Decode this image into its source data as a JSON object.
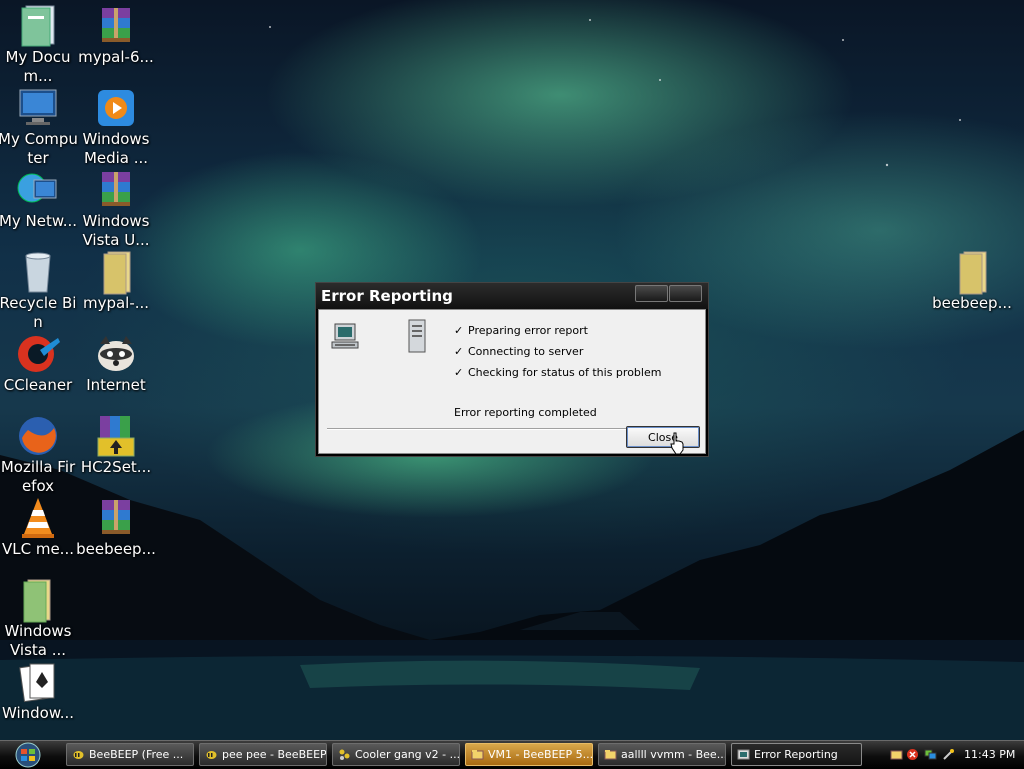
{
  "desktop_icons": [
    {
      "label": "My Docum...",
      "icon": "documents-folder-icon"
    },
    {
      "label": "mypal-6...",
      "icon": "winrar-archive-icon"
    },
    {
      "label": "My Computer",
      "icon": "computer-icon"
    },
    {
      "label": "Windows Media ...",
      "icon": "media-player-icon"
    },
    {
      "label": "My Netw...",
      "icon": "network-globe-icon"
    },
    {
      "label": "Windows Vista U...",
      "icon": "winrar-archive-icon"
    },
    {
      "label": "Recycle Bin",
      "icon": "recycle-bin-icon"
    },
    {
      "label": "mypal-...",
      "icon": "folder-icon"
    },
    {
      "label": "CCleaner",
      "icon": "ccleaner-icon"
    },
    {
      "label": "Internet",
      "icon": "raccoon-browser-icon"
    },
    {
      "label": "Mozilla Firefox",
      "icon": "firefox-icon"
    },
    {
      "label": "HC2Set...",
      "icon": "winrar-installer-icon"
    },
    {
      "label": "VLC me...",
      "icon": "vlc-cone-icon"
    },
    {
      "label": "beebeep...",
      "icon": "winrar-archive-icon"
    },
    {
      "label": "Windows Vista ...",
      "icon": "folder-icon"
    },
    {
      "label": "Window...",
      "icon": "solitaire-cards-icon"
    },
    {
      "label": "beebeep...",
      "icon": "folder-icon"
    }
  ],
  "dialog": {
    "title": "Error Reporting",
    "steps": [
      "Preparing error report",
      "Connecting to server",
      "Checking for status of this problem"
    ],
    "status": "Error reporting completed",
    "close_label": "Close"
  },
  "taskbar": {
    "tasks": [
      "BeeBEEP (Free ...",
      "pee pee - BeeBEEP",
      "Cooler gang v2 - ...",
      "VM1 - BeeBEEP 5...",
      "aallll vvmm - Bee...",
      "Error Reporting"
    ],
    "clock": "11:43 PM"
  },
  "colors": {
    "aurora": "#4fd19a",
    "active_task": "#c8892a",
    "dialog_bg": "#f0f0f0"
  }
}
